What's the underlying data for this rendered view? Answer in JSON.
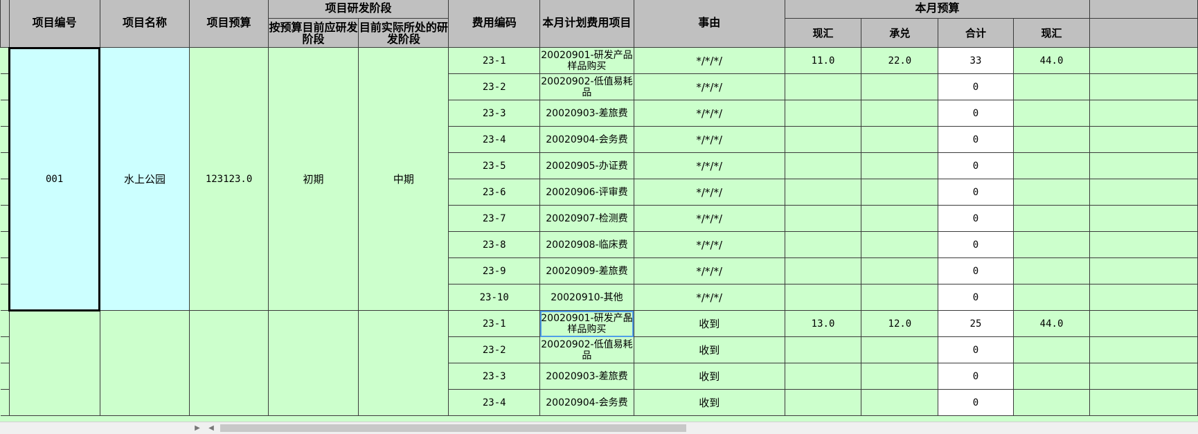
{
  "headers": {
    "project_code": "项目编号",
    "project_name": "项目名称",
    "project_budget": "项目预算",
    "rd_stage": "项目研发阶段",
    "stage_planned": "按预算目前应研发阶段",
    "stage_actual": "目前实际所处的研发阶段",
    "fee_code": "费用编码",
    "plan_item": "本月计划费用项目",
    "reason": "事由",
    "month_budget": "本月预算",
    "cash": "现汇",
    "acceptance": "承兑",
    "total": "合计",
    "cash2": "现汇"
  },
  "project1": {
    "code": "001",
    "name": "水上公园",
    "budget": "123123.0",
    "stage_planned": "初期",
    "stage_actual": "中期",
    "rows": [
      {
        "fee_code": "23-1",
        "item": "20020901-研发产品样品购买",
        "reason": "*/*/*/",
        "cash": "11.0",
        "acceptance": "22.0",
        "total": "33",
        "cash2": "44.0"
      },
      {
        "fee_code": "23-2",
        "item": "20020902-低值易耗品",
        "reason": "*/*/*/",
        "cash": "",
        "acceptance": "",
        "total": "0",
        "cash2": ""
      },
      {
        "fee_code": "23-3",
        "item": "20020903-差旅费",
        "reason": "*/*/*/",
        "cash": "",
        "acceptance": "",
        "total": "0",
        "cash2": ""
      },
      {
        "fee_code": "23-4",
        "item": "20020904-会务费",
        "reason": "*/*/*/",
        "cash": "",
        "acceptance": "",
        "total": "0",
        "cash2": ""
      },
      {
        "fee_code": "23-5",
        "item": "20020905-办证费",
        "reason": "*/*/*/",
        "cash": "",
        "acceptance": "",
        "total": "0",
        "cash2": ""
      },
      {
        "fee_code": "23-6",
        "item": "20020906-评审费",
        "reason": "*/*/*/",
        "cash": "",
        "acceptance": "",
        "total": "0",
        "cash2": ""
      },
      {
        "fee_code": "23-7",
        "item": "20020907-检测费",
        "reason": "*/*/*/",
        "cash": "",
        "acceptance": "",
        "total": "0",
        "cash2": ""
      },
      {
        "fee_code": "23-8",
        "item": "20020908-临床费",
        "reason": "*/*/*/",
        "cash": "",
        "acceptance": "",
        "total": "0",
        "cash2": ""
      },
      {
        "fee_code": "23-9",
        "item": "20020909-差旅费",
        "reason": "*/*/*/",
        "cash": "",
        "acceptance": "",
        "total": "0",
        "cash2": ""
      },
      {
        "fee_code": "23-10",
        "item": "20020910-其他",
        "reason": "*/*/*/",
        "cash": "",
        "acceptance": "",
        "total": "0",
        "cash2": ""
      }
    ]
  },
  "project2": {
    "rows": [
      {
        "fee_code": "23-1",
        "item": "20020901-研发产品样品购买",
        "reason": "收到",
        "cash": "13.0",
        "acceptance": "12.0",
        "total": "25",
        "cash2": "44.0"
      },
      {
        "fee_code": "23-2",
        "item": "20020902-低值易耗品",
        "reason": "收到",
        "cash": "",
        "acceptance": "",
        "total": "0",
        "cash2": ""
      },
      {
        "fee_code": "23-3",
        "item": "20020903-差旅费",
        "reason": "收到",
        "cash": "",
        "acceptance": "",
        "total": "0",
        "cash2": ""
      },
      {
        "fee_code": "23-4",
        "item": "20020904-会务费",
        "reason": "收到",
        "cash": "",
        "acceptance": "",
        "total": "0",
        "cash2": ""
      }
    ]
  },
  "colors": {
    "header_bg": "#c0c0c0",
    "green": "#ccffcc",
    "cyan": "#ccffff",
    "white": "#ffffff",
    "selection": "#4f9ee8"
  }
}
